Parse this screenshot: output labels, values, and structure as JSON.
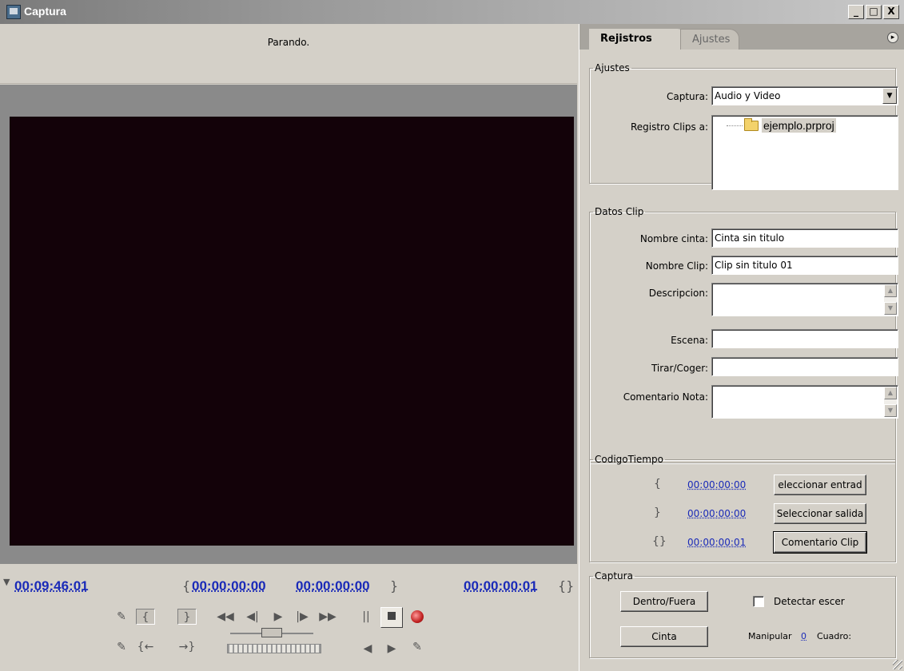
{
  "window": {
    "title": "Captura",
    "controls": {
      "minimize": "_",
      "maximize": "□",
      "close": "X"
    }
  },
  "monitor": {
    "status": "Parando.",
    "timecodes": {
      "current": "00:09:46:01",
      "in_point": "00:00:00:00",
      "out_point": "00:00:00:00",
      "duration": "00:00:00:01"
    }
  },
  "transport": {
    "buttons": [
      "set-in-clap",
      "mark-in",
      "mark-out",
      "rewind",
      "step-back",
      "play",
      "step-forward",
      "fast-forward",
      "pause",
      "stop",
      "record",
      "set-out-clap",
      "go-to-in",
      "go-to-out",
      "slow-reverse",
      "slow-play",
      "scene-search"
    ]
  },
  "panel": {
    "tabs": [
      {
        "label": "Rejistros",
        "active": true
      },
      {
        "label": "Ajustes",
        "active": false
      }
    ],
    "ajustes": {
      "legend": "Ajustes",
      "captura_label": "Captura:",
      "captura_value": "Audio y Video",
      "registro_label": "Registro Clips a:",
      "project": "ejemplo.prproj"
    },
    "datos_clip": {
      "legend": "Datos Clip",
      "nombre_cinta_label": "Nombre cinta:",
      "nombre_cinta_value": "Cinta sin titulo",
      "nombre_clip_label": "Nombre Clip:",
      "nombre_clip_value": "Clip sin titulo 01",
      "descripcion_label": "Descripcion:",
      "descripcion_value": "",
      "escena_label": "Escena:",
      "escena_value": "",
      "tirar_label": "Tirar/Coger:",
      "tirar_value": "",
      "comentario_label": "Comentario Nota:",
      "comentario_value": ""
    },
    "codigo_tiempo": {
      "legend": "CodigoTiempo",
      "in_value": "00:00:00:00",
      "in_button": "eleccionar entrad",
      "out_value": "00:00:00:00",
      "out_button": "Seleccionar salida",
      "dur_value": "00:00:00:01",
      "dur_button": "Comentario Clip"
    },
    "captura": {
      "legend": "Captura",
      "dentro_fuera": "Dentro/Fuera",
      "cinta": "Cinta",
      "detectar_label": "Detectar escer",
      "detectar_checked": false,
      "manipular_label": "Manipular",
      "manipular_value": "0",
      "cuadro_label": "Cuadro:"
    }
  },
  "colors": {
    "timecode": "#1a2ab8",
    "monitor_bg": "#130209",
    "chrome": "#d4d0c8"
  }
}
